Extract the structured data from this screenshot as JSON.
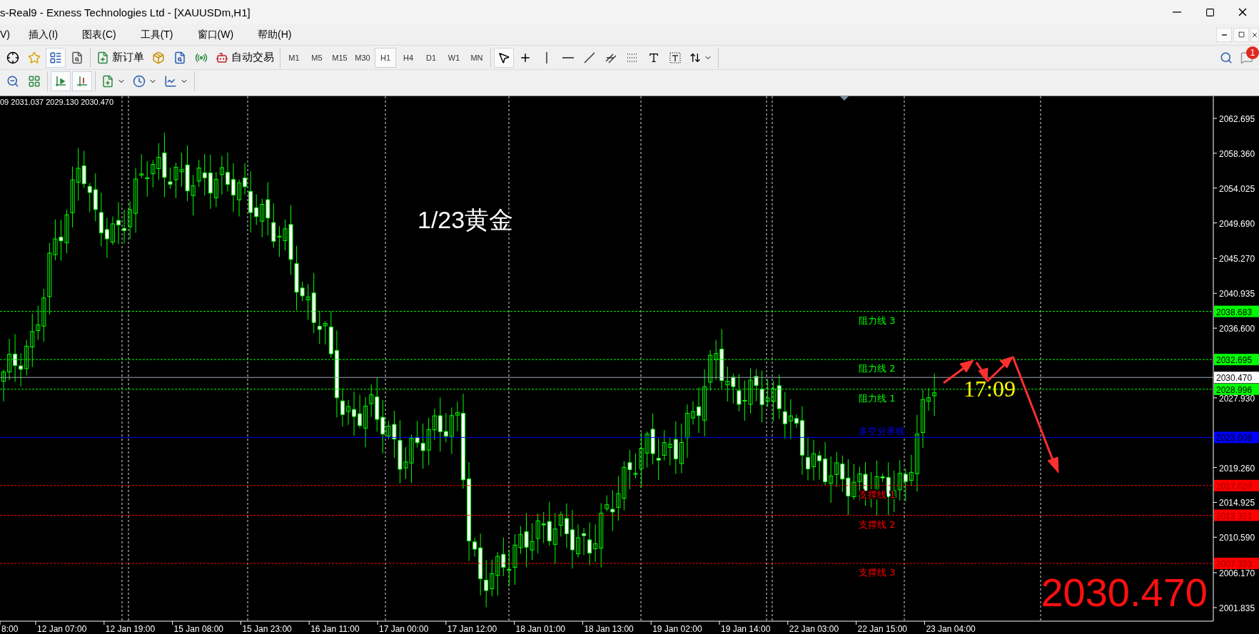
{
  "window": {
    "title": "s-Real9 - Exness Technologies Ltd - [XAUUSDm,H1]"
  },
  "menu": [
    "V)",
    "插入(I)",
    "图表(C)",
    "工具(T)",
    "窗口(W)",
    "帮助(H)"
  ],
  "standard_toolbar": {
    "icon_buttons": [
      {
        "pressed": false
      },
      {
        "pressed": false
      },
      {
        "pressed": true
      },
      {
        "pressed": false
      }
    ],
    "new_order": "新订单",
    "auto_trading": "自动交易"
  },
  "timeframes": [
    {
      "label": "M1",
      "selected": false
    },
    {
      "label": "M5",
      "selected": false
    },
    {
      "label": "M15",
      "selected": false
    },
    {
      "label": "M30",
      "selected": false
    },
    {
      "label": "H1",
      "selected": true
    },
    {
      "label": "H4",
      "selected": false
    },
    {
      "label": "D1",
      "selected": false
    },
    {
      "label": "W1",
      "selected": false
    },
    {
      "label": "MN",
      "selected": false
    }
  ],
  "drawing_tools": [
    {
      "pressed": true
    },
    {
      "pressed": false
    },
    {
      "pressed": false
    },
    {
      "pressed": false
    },
    {
      "pressed": false
    },
    {
      "pressed": false
    },
    {
      "pressed": false
    },
    {
      "pressed": false
    },
    {
      "pressed": false
    },
    {
      "pressed": false
    }
  ],
  "chart_toolbar": [
    {
      "pressed": false
    },
    {
      "pressed": false
    },
    {
      "pressed": true
    },
    {
      "pressed": true
    },
    {
      "pressed": false
    },
    {
      "pressed": false
    },
    {
      "pressed": false
    }
  ],
  "notifications": {
    "count": "1"
  },
  "chart": {
    "ohlc": "09 2031.037 2029.130 2030.470",
    "caption": "1/23黄金",
    "time_mark": "17:09",
    "big_price": "2030.470",
    "price_ticks": [
      "2062.695",
      "2058.360",
      "2054.025",
      "2049.690",
      "2045.270",
      "2040.935",
      "2036.600",
      "2027.930",
      "2019.260",
      "2014.925",
      "2010.590",
      "2006.170",
      "2001.835"
    ],
    "levels": [
      {
        "label": "阻力线 3",
        "price": "2038.683",
        "color": "#00ff00"
      },
      {
        "label": "阻力线 2",
        "price": "2032.695",
        "color": "#00ff00"
      },
      {
        "label": "阻力线 1",
        "price": "2028.996",
        "color": "#00ff00"
      },
      {
        "label": "多空分界线",
        "price": "2023.008",
        "color": "#0000ff"
      },
      {
        "label": "支撑线 1",
        "price": "2017.020",
        "color": "#ff0000"
      },
      {
        "label": "支撑线 2",
        "price": "2013.321",
        "color": "#ff0000"
      },
      {
        "label": "支撑线 3",
        "price": "2007.333",
        "color": "#ff0000"
      }
    ],
    "bid": {
      "price": "2030.470"
    },
    "time_labels": [
      "8:00",
      "12 Jan 07:00",
      "12 Jan 19:00",
      "15 Jan 08:00",
      "15 Jan 23:00",
      "16 Jan 11:00",
      "17 Jan 00:00",
      "17 Jan 12:00",
      "18 Jan 01:00",
      "18 Jan 13:00",
      "19 Jan 02:00",
      "19 Jan 14:00",
      "22 Jan 03:00",
      "22 Jan 15:00",
      "23 Jan 04:00"
    ]
  }
}
